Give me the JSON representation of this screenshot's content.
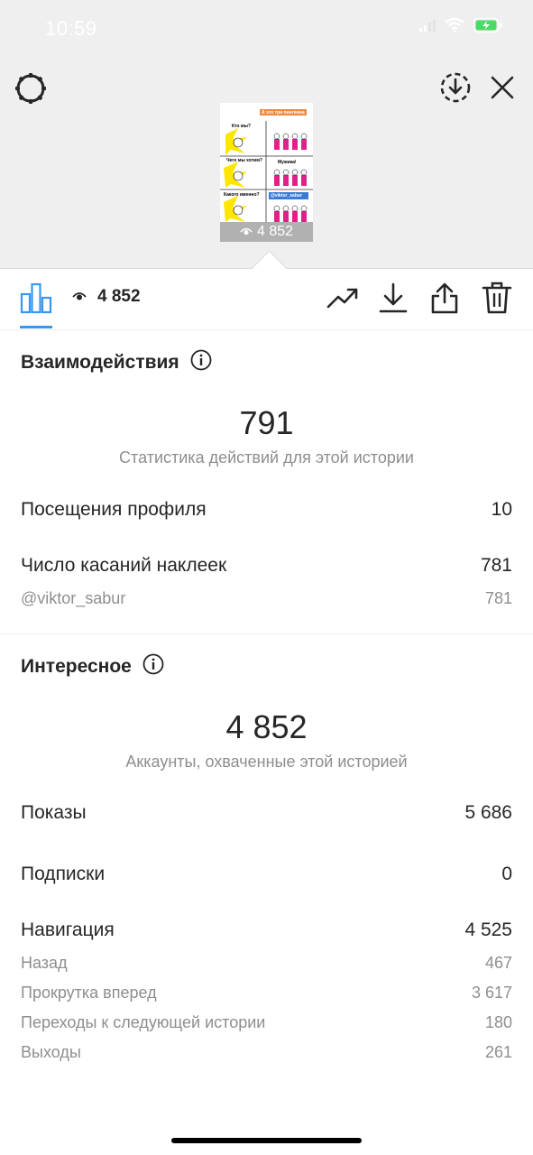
{
  "status_bar": {
    "time": "10:59"
  },
  "story_preview": {
    "views": "4 852",
    "panels": [
      "Кто мы?",
      "Чего мы хотим?",
      "Какого именно?",
      "Мужика!"
    ],
    "mention_sticker": "@viktor_sabur",
    "top_sticker": "А это три пингвина"
  },
  "toolbar": {
    "views": "4 852"
  },
  "interactions": {
    "title": "Взаимодействия",
    "total": "791",
    "caption": "Статистика действий для этой истории",
    "rows": [
      {
        "label": "Посещения профиля",
        "value": "10"
      },
      {
        "label": "Число касаний наклеек",
        "value": "781"
      }
    ],
    "sub_rows": [
      {
        "label": "@viktor_sabur",
        "value": "781"
      }
    ]
  },
  "discovery": {
    "title": "Интересное",
    "total": "4 852",
    "caption": "Аккаунты, охваченные этой историей",
    "rows": [
      {
        "label": "Показы",
        "value": "5 686"
      },
      {
        "label": "Подписки",
        "value": "0"
      },
      {
        "label": "Навигация",
        "value": "4 525"
      }
    ],
    "nav_sub_rows": [
      {
        "label": "Назад",
        "value": "467"
      },
      {
        "label": "Прокрутка вперед",
        "value": "3 617"
      },
      {
        "label": "Переходы к следующей истории",
        "value": "180"
      },
      {
        "label": "Выходы",
        "value": "261"
      }
    ]
  },
  "colors": {
    "accent": "#3897f0",
    "battery": "#4cd964",
    "muted": "#8e8e8e",
    "text": "#262626"
  }
}
